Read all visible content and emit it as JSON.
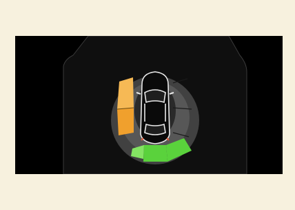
{
  "display": {
    "left_sensors_level": 0.5,
    "front_sensors_level": 0,
    "rear_sensors_level": 0.25
  },
  "colors": {
    "page_background": "#f7f1de",
    "screen_background": "#000000",
    "panel_background": "#0f0f0f",
    "panel_outline": "#3a3a3a",
    "zone_inactive": "#414141",
    "zone_inactive_inner": "#575757",
    "warning_orange": "#f0a02d",
    "warning_orange_light": "#f6b955",
    "proximity_green": "#5ad23c",
    "proximity_green_light": "#84e463",
    "car_outline": "#e9e9e9"
  },
  "icons": {
    "vehicle": "car-top-view-icon"
  }
}
